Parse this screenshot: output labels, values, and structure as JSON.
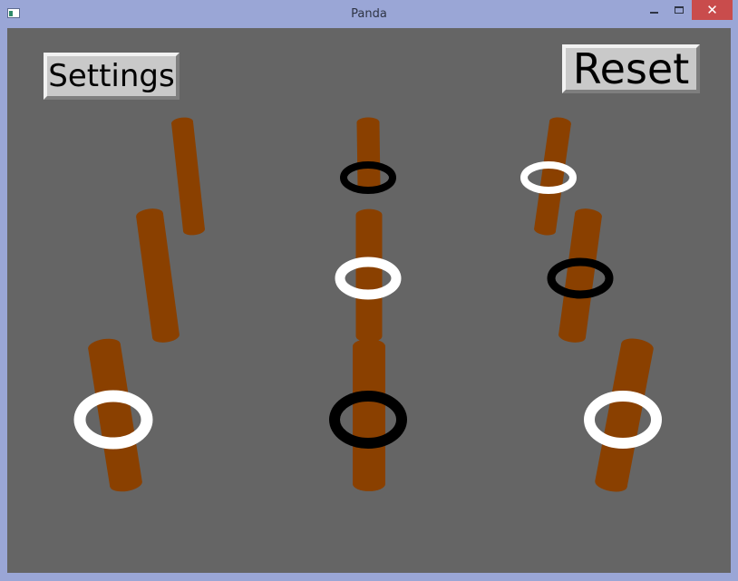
{
  "window": {
    "title": "Panda"
  },
  "buttons": {
    "settings": "Settings",
    "reset": "Reset"
  },
  "colors": {
    "background": "#656565",
    "peg": "#8a4000",
    "ring_white": "#ffffff",
    "ring_black": "#000000",
    "frame": "#9aa6d6"
  },
  "board": {
    "pegs": [
      {
        "id": "peg-1",
        "ring": "none"
      },
      {
        "id": "peg-2",
        "ring": "black"
      },
      {
        "id": "peg-3",
        "ring": "white"
      },
      {
        "id": "peg-4",
        "ring": "none"
      },
      {
        "id": "peg-5",
        "ring": "white"
      },
      {
        "id": "peg-6",
        "ring": "black"
      },
      {
        "id": "peg-7",
        "ring": "white"
      },
      {
        "id": "peg-8",
        "ring": "black"
      },
      {
        "id": "peg-9",
        "ring": "white"
      }
    ]
  }
}
